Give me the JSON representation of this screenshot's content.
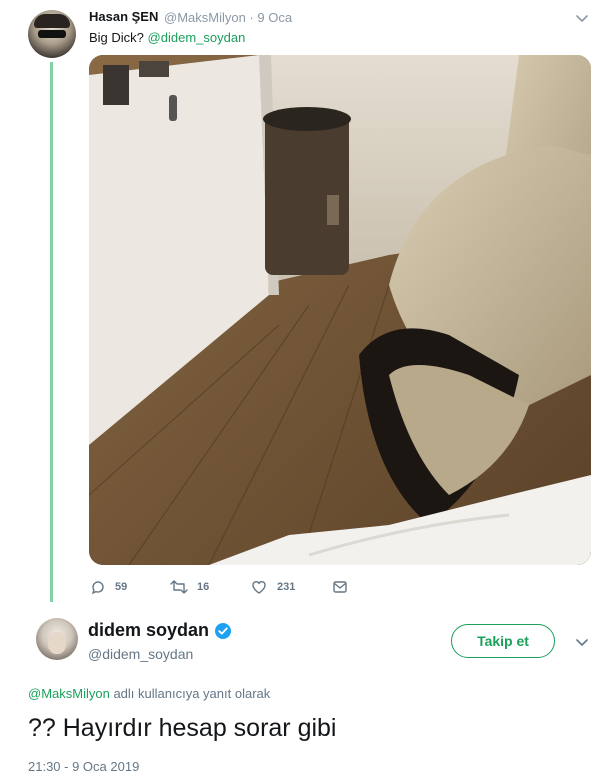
{
  "quoted_tweet": {
    "author_name": "Hasan ŞEN",
    "meta": "@MaksMilyon · 9 Oca",
    "text_prefix": "Big Dick?",
    "text_mention": "@didem_soydan",
    "media_icon": "photo-of-room",
    "actions": {
      "reply_count": "59",
      "retweet_count": "16",
      "like_count": "231"
    }
  },
  "main_tweet": {
    "author_name": "didem soydan",
    "handle": "@didem_soydan",
    "verified_icon": "verified-badge-icon",
    "follow_label": "Takip et",
    "reply_to_mention": "@MaksMilyon",
    "reply_to_text": "adlı kullanıcıya yanıt olarak",
    "text": "?? Hayırdır hesap sorar gibi",
    "timestamp": "21:30 - 9 Oca 2019"
  },
  "colors": {
    "accent": "#1aa05a",
    "thread_line": "#7fd3a4",
    "muted": "#657786",
    "verified": "#1da1f2"
  }
}
